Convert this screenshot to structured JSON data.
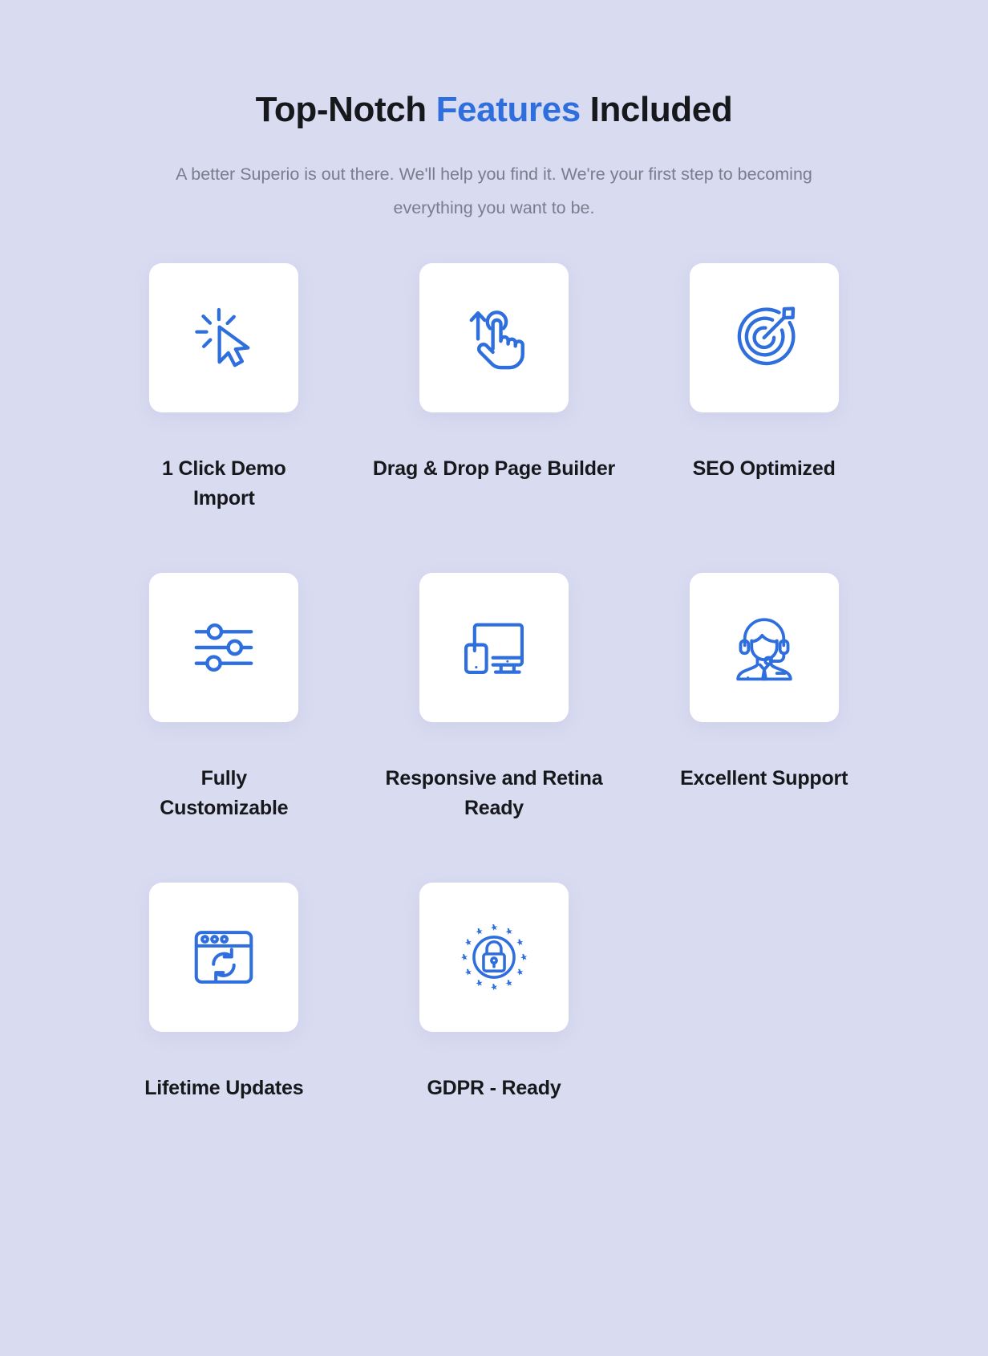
{
  "section": {
    "heading": {
      "part1": "Top-Notch ",
      "accent": "Features",
      "part2": " Included",
      "accent_color": "#2f6fdd"
    },
    "subtitle": "A better Superio is out there. We'll help you find it. We're your first step to becoming everything you want to be.",
    "background_color": "#d9dbf1",
    "card_color": "#ffffff",
    "icon_color": "#2f6fdd",
    "label_color": "#17181c",
    "subtitle_color": "#7b7d8c"
  },
  "features": [
    {
      "label": "1 Click Demo Import",
      "icon": "cursor-click-icon"
    },
    {
      "label": "Drag & Drop Page Builder",
      "icon": "drag-hand-icon"
    },
    {
      "label": "SEO Optimized",
      "icon": "target-dart-icon"
    },
    {
      "label": "Fully Customizable",
      "icon": "sliders-icon"
    },
    {
      "label": "Responsive and Retina Ready",
      "icon": "devices-icon"
    },
    {
      "label": "Excellent Support",
      "icon": "support-agent-icon"
    },
    {
      "label": "Lifetime Updates",
      "icon": "browser-refresh-icon"
    },
    {
      "label": "GDPR - Ready",
      "icon": "gdpr-lock-icon"
    }
  ]
}
